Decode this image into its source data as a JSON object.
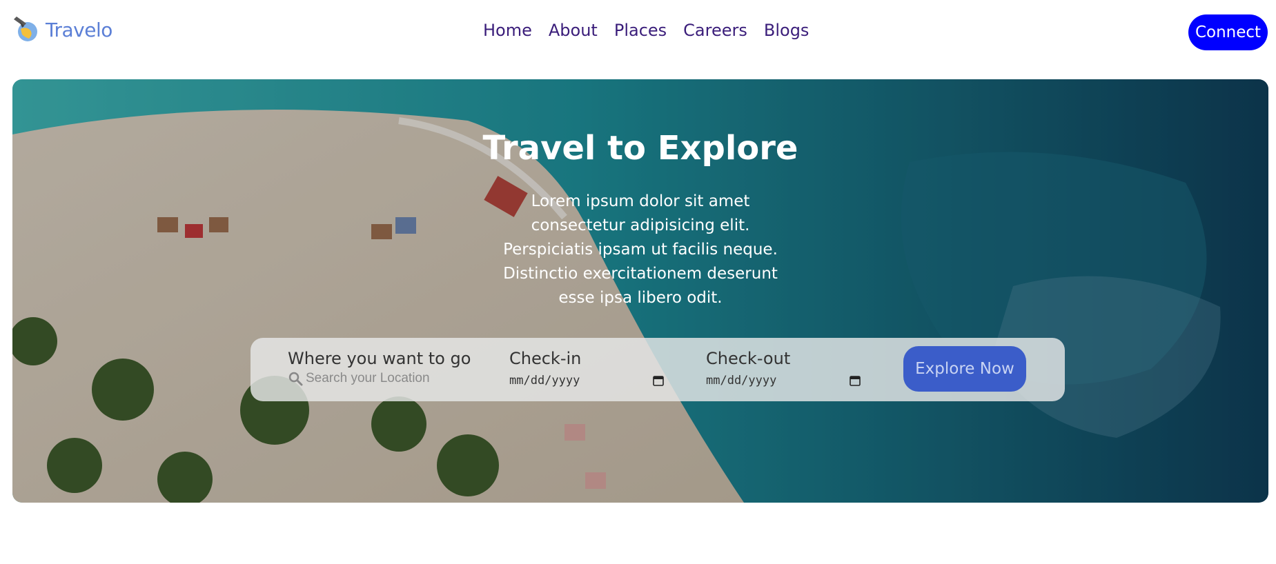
{
  "brand": {
    "name": "Travelo",
    "color": "#5b7fd6",
    "icon": "plane-globe-icon"
  },
  "nav": {
    "color": "#3a1d7a",
    "items": [
      "Home",
      "About",
      "Places",
      "Careers",
      "Blogs"
    ]
  },
  "header": {
    "connect_label": "Connect",
    "connect_color": "#0000ff"
  },
  "hero": {
    "title": "Travel to Explore",
    "text": "Lorem ipsum dolor sit amet consectetur adipisicing elit. Perspiciatis ipsam ut facilis neque. Distinctio exercitationem deserunt esse ipsa libero odit."
  },
  "search": {
    "where_label": "Where you want to go",
    "where_placeholder": "Search your Location",
    "checkin_label": "Check-in",
    "checkin_value": "mm/dd/yyyy",
    "checkout_label": "Check-out",
    "checkout_value": "mm/dd/yyyy",
    "explore_label": "Explore Now",
    "explore_color": "#3b5dc9"
  }
}
